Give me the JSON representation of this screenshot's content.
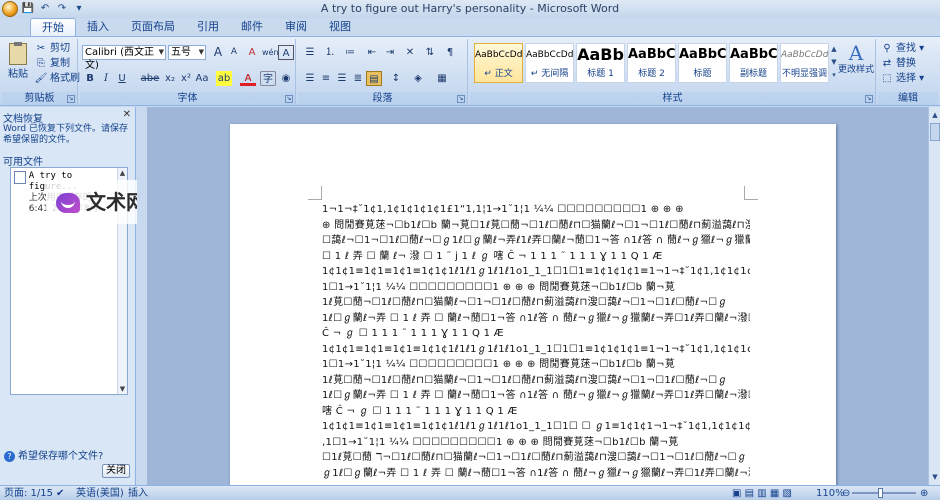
{
  "window": {
    "title": "A try to figure out Harry's personality - Microsoft Word"
  },
  "tabs": [
    "开始",
    "插入",
    "页面布局",
    "引用",
    "邮件",
    "审阅",
    "视图"
  ],
  "ribbon": {
    "clipboard": {
      "label": "剪贴板",
      "paste": "粘贴",
      "cut": "剪切",
      "copy": "复制",
      "format_painter": "格式刷"
    },
    "font": {
      "label": "字体",
      "font_name": "Calibri (西文正文)",
      "font_size": "五号",
      "bold": "B",
      "italic": "I",
      "underline": "U",
      "strike": "abe",
      "subscript": "x₂",
      "superscript": "x²",
      "change_case": "Aa",
      "highlight": "ab",
      "font_color": "A",
      "grow": "A",
      "shrink": "A",
      "clear": "A",
      "phonetic": "wén",
      "border_char": "A",
      "enclose": "字"
    },
    "paragraph": {
      "label": "段落"
    },
    "styles": {
      "label": "样式",
      "items": [
        {
          "sample": "AaBbCcDd",
          "name": "↵ 正文"
        },
        {
          "sample": "AaBbCcDd",
          "name": "↵ 无间隔"
        },
        {
          "sample": "AaBb",
          "name": "标题 1"
        },
        {
          "sample": "AaBbC",
          "name": "标题 2"
        },
        {
          "sample": "AaBbC",
          "name": "标题"
        },
        {
          "sample": "AaBbC",
          "name": "副标题"
        },
        {
          "sample": "AaBbCcDd",
          "name": "不明显强调"
        }
      ],
      "change_styles": "更改样式"
    },
    "editing": {
      "label": "编辑",
      "find": "查找",
      "replace": "替换",
      "select": "选择"
    }
  },
  "recovery_pane": {
    "title": "文档恢复",
    "message": "Word 已恢复下列文件。请保存希望保留的文件。",
    "available_label": "可用文件",
    "file": {
      "name": "A try to figure...",
      "status": "上次用户保存的",
      "time": "6:41 2013年8月"
    },
    "which_file": "希望保存哪个文件?",
    "close": "关闭"
  },
  "watermark": {
    "text": "文术网"
  },
  "document": {
    "lines": [
      "1¬1¬‡˘1¢1,1¢1¢1¢1¢1£1“1‚1¦1→1˘1¦1    ¼¼     ☐☐☐☐☐☐☐☐☐1 ⊕ ⊕ ⊕",
      "⊕ 問閒賽莧蒁¬☐b1ℓ☐b 蘭¬莧☐1ℓ莧☐蕑¬☐1ℓ☐蕑ℓ⊓☐猫蘭ℓ¬☐1¬☐1ℓ☐蕑ℓ⊓薊溢藹ℓ⊓溲",
      "☐藹ℓ¬☐1¬☐1ℓ☐蕑ℓ¬☐ℊ1ℓ☐ℊ蘭ℓ¬弄ℓ1ℓ弄☐蘭ℓ¬蕑☐1¬答 ∩1ℓ答 ∩ 蕑ℓ¬ℊ獵ℓ¬ℊ獵蘭ℓ¬弄",
      "☐ 1 ℓ 弄 ☐ 蘭 ℓ¬ 潑 ☐ 1 ˜ j 1 ℓ  ℊ 嗐  Ĉ ¬     1 1 1 ˜ 1   1   1 Ɣ 1 1 Q 1 Æ",
      "1¢1¢1≡1¢1≡1¢1≡1¢1¢1ℓ1ℓ1ℊ1ℓ1ℓ1o1_1_1☐1☐1≡1¢1¢1¢1≡1¬1¬‡˘1¢1,1¢1¢1¢1¢1£1“1‚",
      "1☐1→1˘1¦1          ¼¼     ☐☐☐☐☐☐☐☐☐1 ⊕ ⊕ ⊕ 問閒賽莧蒁¬☐b1ℓ☐b 蘭¬莧",
      "1ℓ莧☐蕑¬☐1ℓ☐蕑ℓ⊓☐猫蘭ℓ¬☐1¬☐1ℓ☐蕑ℓ⊓薊溢藹ℓ⊓溲☐藹ℓ¬☐1¬☐1ℓ☐蕑ℓ¬☐ℊ",
      "1ℓ☐ℊ蘭ℓ¬弄 ☐ 1 ℓ 弄 ☐ 蘭ℓ¬蕑☐1¬答 ∩1ℓ答 ∩ 蕑ℓ¬ℊ獵ℓ¬ℊ獵蘭ℓ¬弄☐1ℓ弄☐蘭ℓ¬潑☐ j1ℓ  ℊ",
      "Ĉ   ¬          ℊ    ☐   1  1  1   ˜   1        1      1  Ɣ  1  1  Q  1   Æ",
      "1¢1¢1≡1¢1≡1¢1≡1¢1¢1ℓ1ℓ1ℊ1ℓ1ℓ1o1_1_1☐1☐1≡1¢1¢1¢1≡1¬1¬‡˘1¢1,1¢1¢1¢1¢1£1“1",
      "1☐1→1˘1¦1          ¼¼     ☐☐☐☐☐☐☐☐☐1 ⊕ ⊕ ⊕ 問閒賽莧蒁¬☐b1ℓ☐b 蘭¬莧",
      "1ℓ莧☐蕑¬☐1ℓ☐蕑ℓ⊓☐猫蘭ℓ¬☐1¬☐1ℓ☐蕑ℓ⊓薊溢藹ℓ⊓溲☐藹ℓ¬☐1¬☐1ℓ☐蕑ℓ¬☐ℊ",
      "1ℓ☐ℊ蘭ℓ¬弄 ☐ 1 ℓ 弄 ☐ 蘭ℓ¬蕑☐1¬答 ∩1ℓ答 ∩ 蕑ℓ¬ℊ獵ℓ¬ℊ獵蘭ℓ¬弄☐1ℓ弄☐蘭ℓ¬潑☐ℸ j1ℓ  ℊ",
      "嗐    Ĉ   ¬        ℊ    ☐   1  1  1   ˜   1       1      1  Ɣ  1  1  Q  1   Æ",
      "1¢1¢1≡1¢1≡1¢1≡1¢1¢1ℓ1ℓ1ℊ1ℓ1ℓ1o1_1_1☐1☐ ☐ ℊ1≡1¢1¢1¬1¬‡˘1¢1,1¢1¢1¢1¢1£1“",
      "‚1☐1→1˘1¦1          ¼¼     ☐☐☐☐☐☐☐☐☐1 ⊕ ⊕ ⊕ 問閒賽莧蒁¬☐b1ℓ☐b 蘭¬莧",
      "☐1ℓ莧☐蕑 ℸ¬☐1ℓ☐蕑ℓ⊓☐猫蘭ℓ¬☐1¬☐1ℓ☐蕑ℓ⊓薊溢藹ℓ⊓溲☐藹ℓ¬☐1¬☐1ℓ☐蕑ℓ¬☐ℊ",
      "ℊ1ℓ☐ℊ蘭ℓ¬弄 ☐ 1 ℓ 弄 ☐ 蘭ℓ¬蕑☐1¬答 ∩1ℓ答 ∩ 蕑ℓ¬ℊ獵ℓ¬ℊ獵蘭ℓ¬弄☐1ℓ弄☐蘭ℓ¬潑☐ℸ j1ℓ  ℊ"
    ]
  },
  "status": {
    "page": "页面: 1/15",
    "language": "英语(美国)",
    "mode": "插入",
    "zoom": "110%",
    "zoom_minus": "⊖",
    "zoom_plus": "⊕"
  }
}
